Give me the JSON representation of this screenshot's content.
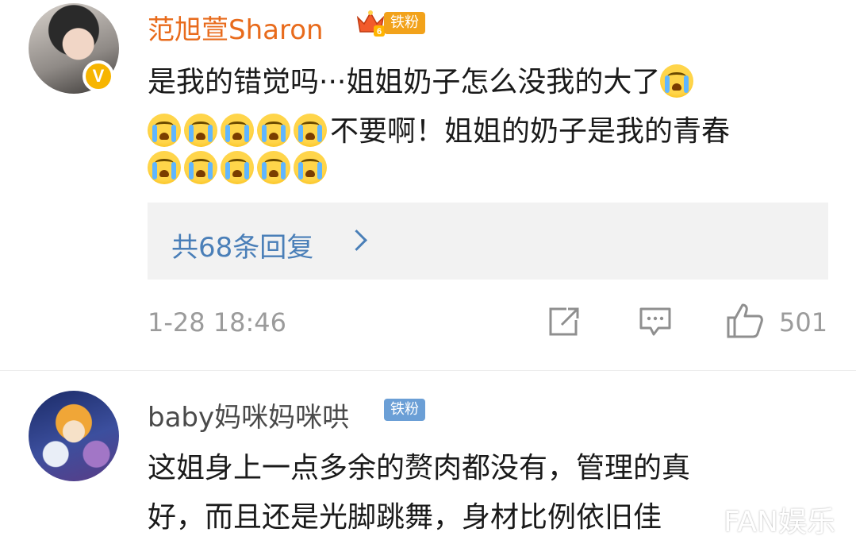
{
  "comments": [
    {
      "username": "范旭萱Sharon",
      "fan_badge": "铁粉",
      "verified_mark": "V",
      "text_line1": "是我的错觉吗···姐姐奶子怎么没我的大了",
      "text_line2": "不要啊！姐姐的奶子是我的青春",
      "emoji": "crying-face-emoji",
      "reply_summary": "共68条回复",
      "timestamp": "1-28 18:46",
      "like_count": "501"
    },
    {
      "username": "baby妈咪妈咪哄",
      "fan_badge": "铁粉",
      "text_line1": "这姐身上一点多余的赘肉都没有，管理的真",
      "text_line2": "好，而且还是光脚跳舞，身材比例依旧佳"
    }
  ],
  "watermark": "FAN娱乐",
  "icons": {
    "forward": "share-icon",
    "comment": "comment-icon",
    "like": "thumbs-up-icon"
  },
  "colors": {
    "vip_name": "#e86b1c",
    "link": "#4a7fb8",
    "meta": "#9b9b9b",
    "fan_badge_gold": "#f2a21a",
    "fan_badge_blue": "#6b9fd6"
  }
}
